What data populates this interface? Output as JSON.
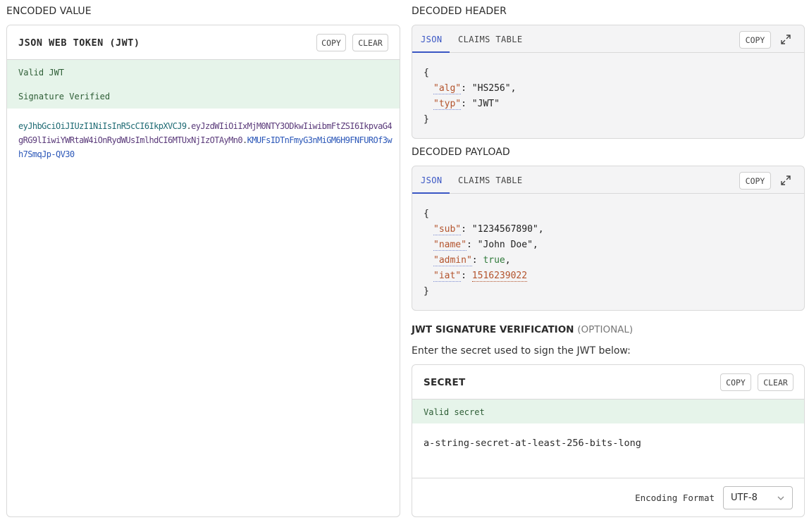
{
  "encoded_section": {
    "title": "ENCODED VALUE",
    "panel_title": "JSON WEB TOKEN (JWT)",
    "copy_label": "COPY",
    "clear_label": "CLEAR",
    "status_valid": "Valid JWT",
    "status_signature": "Signature Verified",
    "token": {
      "header_part": "eyJhbGciOiJIUzI1NiIsInR5cCI6IkpXVCJ9",
      "payload_part": "eyJzdWIiOiIxMjM0NTY3ODkwIiwibmFtZSI6IkpvaG4gRG9lIiwiYWRtaW4iOnRydWUsImlhdCI6MTUxNjIzOTAyMn0",
      "signature_part": "KMUFsIDTnFmyG3nMiGM6H9FNFUROf3wh7SmqJp-QV30",
      "dot": "."
    }
  },
  "decoded_header": {
    "title": "DECODED HEADER",
    "tab_json": "JSON",
    "tab_claims": "CLAIMS TABLE",
    "copy_label": "COPY",
    "open_brace": "{",
    "close_brace": "}",
    "fields": [
      {
        "key": "\"alg\"",
        "value": "\"HS256\"",
        "sep": ": ",
        "trail": ","
      },
      {
        "key": "\"typ\"",
        "value": "\"JWT\"",
        "sep": ": ",
        "trail": ""
      }
    ]
  },
  "decoded_payload": {
    "title": "DECODED PAYLOAD",
    "tab_json": "JSON",
    "tab_claims": "CLAIMS TABLE",
    "copy_label": "COPY",
    "open_brace": "{",
    "close_brace": "}",
    "fields": [
      {
        "key": "\"sub\"",
        "value": "\"1234567890\"",
        "sep": ": ",
        "trail": ","
      },
      {
        "key": "\"name\"",
        "value": "\"John Doe\"",
        "sep": ": ",
        "trail": ","
      },
      {
        "key": "\"admin\"",
        "value": "true",
        "sep": ": ",
        "trail": ","
      },
      {
        "key": "\"iat\"",
        "value": "1516239022",
        "sep": ": ",
        "trail": ""
      }
    ]
  },
  "signature": {
    "title": "JWT SIGNATURE VERIFICATION",
    "optional": "(OPTIONAL)",
    "description": "Enter the secret used to sign the JWT below:",
    "panel_title": "SECRET",
    "copy_label": "COPY",
    "clear_label": "CLEAR",
    "status_valid": "Valid secret",
    "secret_value": "a-string-secret-at-least-256-bits-long",
    "encoding_label": "Encoding Format",
    "encoding_value": "UTF-8"
  },
  "colors": {
    "accent": "#3a56c4",
    "valid_bg": "#e6f4ea",
    "valid_text": "#2e5e36",
    "key": "#b3532c",
    "bool": "#2f7a3a"
  },
  "icons": {
    "expand": "expand-diagonal-icon",
    "chevron": "chevron-down-icon"
  }
}
